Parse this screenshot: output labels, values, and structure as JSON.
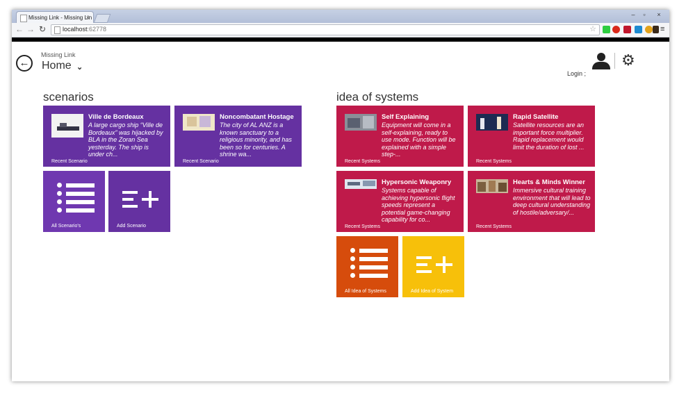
{
  "browser": {
    "tab_title": "Missing Link - Missing Lin",
    "tab_close": "×",
    "url_host": "localhost",
    "url_port": ":62778",
    "window_controls": [
      "–",
      "▫",
      "×"
    ]
  },
  "header": {
    "app_name": "Missing Link",
    "page_title": "Home",
    "login_label": "Login ;"
  },
  "scenarios": {
    "title": "scenarios",
    "recent": [
      {
        "title": "Ville de Bordeaux",
        "description": "A large cargo ship “Ville de Bordeaux” was hijacked by BLA in the Zoran Sea yesterday. The ship is under ch...",
        "footer": "Recent Scenario"
      },
      {
        "title": "Noncombatant Hostage",
        "description": "The city of AL ANZ is a known sanctuary to a religious minority, and has been so for centuries. A shrine wa...",
        "footer": "Recent Scenario"
      }
    ],
    "all_label": "All Scenario's",
    "add_label": "Add Scenario"
  },
  "systems": {
    "title": "idea of systems",
    "recent": [
      {
        "title": "Self Explaining",
        "description": "Equipment will come in a self-explaining, ready to use mode. Function will be explained with a simple step-...",
        "footer": "Recent Systems"
      },
      {
        "title": "Rapid Satellite",
        "description": "Satellite resources are an important force multiplier. Rapid replacement would limit the duration of lost ...",
        "footer": "Recent Systems"
      },
      {
        "title": "Hypersonic Weaponry",
        "description": "Systems capable of achieving hypersonic flight speeds represent a potential game-changing capability for co...",
        "footer": "Recent Systems"
      },
      {
        "title": "Hearts & Minds Winner",
        "description": "Immersive cultural training environment that will lead to deep cultural understanding of hostile/adversary/...",
        "footer": "Recent Systems"
      }
    ],
    "all_label": "All Idea of Systems",
    "add_label": "Add Idea of System"
  },
  "colors": {
    "scenario_tile": "#6531a1",
    "scenario_nav_tile": "#6f38b0",
    "system_tile": "#bf1a4a",
    "all_systems_tile": "#d64c0c",
    "add_system_tile": "#f7c00a"
  },
  "icons": {
    "back": "back-arrow-circle-icon",
    "chevron": "chevron-down-icon",
    "user": "user-icon",
    "settings": "gear-icon",
    "list": "list-icon",
    "add": "add-list-icon"
  }
}
